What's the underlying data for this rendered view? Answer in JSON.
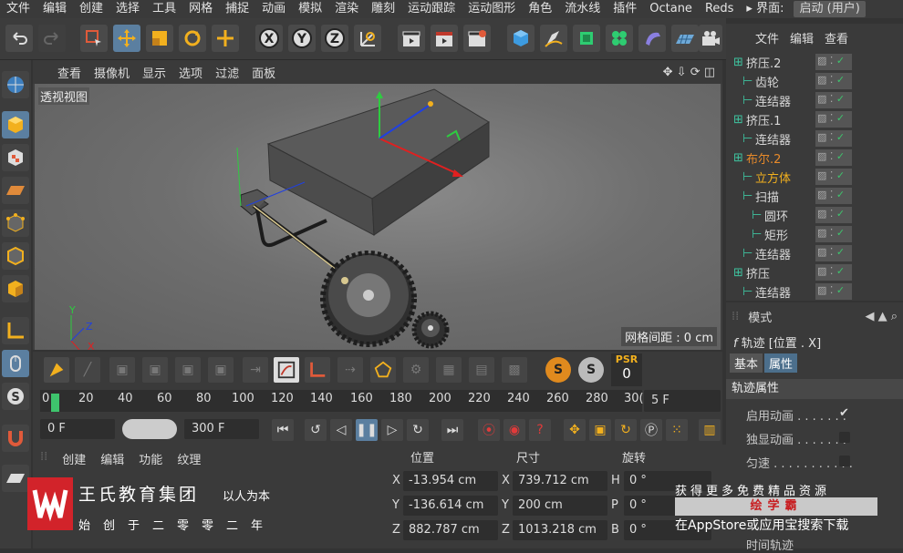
{
  "menubar": {
    "items": [
      "文件",
      "编辑",
      "创建",
      "选择",
      "工具",
      "网格",
      "捕捉",
      "动画",
      "模拟",
      "渲染",
      "雕刻",
      "运动跟踪",
      "运动图形",
      "角色",
      "流水线",
      "插件",
      "Octane",
      "Reds"
    ],
    "layout_label": "界面:",
    "layout_value": "启动 (用户)"
  },
  "viewport": {
    "menu": [
      "查看",
      "摄像机",
      "显示",
      "选项",
      "过滤",
      "面板"
    ],
    "view_name": "透视视图",
    "grid_spacing": "网格间距 : 0 cm"
  },
  "anim": {
    "psr": "PSR",
    "psr_value": "0"
  },
  "timeline": {
    "ticks": [
      "0",
      "20",
      "40",
      "60",
      "80",
      "100",
      "120",
      "140",
      "160",
      "180",
      "200",
      "220",
      "240",
      "260",
      "280",
      "30("
    ],
    "current_frame": "5 F"
  },
  "transport": {
    "start": "0 F",
    "end": "300 F"
  },
  "material": {
    "menu": [
      "创建",
      "编辑",
      "功能",
      "纹理"
    ]
  },
  "coords": {
    "headers": [
      "位置",
      "尺寸",
      "旋转"
    ],
    "rows": [
      {
        "axis": "X",
        "pos": "-13.954 cm",
        "size_axis": "X",
        "size": "739.712 cm",
        "rot_axis": "H",
        "rot": "0 °"
      },
      {
        "axis": "Y",
        "pos": "-136.614 cm",
        "size_axis": "Y",
        "size": "200 cm",
        "rot_axis": "P",
        "rot": "0 °"
      },
      {
        "axis": "Z",
        "pos": "882.787 cm",
        "size_axis": "Z",
        "size": "1013.218 cm",
        "rot_axis": "B",
        "rot": "0 °"
      }
    ]
  },
  "objects": {
    "menu": [
      "文件",
      "编辑",
      "查看"
    ],
    "items": [
      {
        "name": "挤压.2",
        "indent": 0,
        "color": "#d8d8d8"
      },
      {
        "name": "齿轮",
        "indent": 1,
        "color": "#d8d8d8"
      },
      {
        "name": "连结器",
        "indent": 1,
        "color": "#d8d8d8"
      },
      {
        "name": "挤压.1",
        "indent": 0,
        "color": "#d8d8d8"
      },
      {
        "name": "连结器",
        "indent": 1,
        "color": "#d8d8d8"
      },
      {
        "name": "布尔.2",
        "indent": 0,
        "color": "#e88a2a"
      },
      {
        "name": "立方体",
        "indent": 1,
        "color": "#f2b01e"
      },
      {
        "name": "扫描",
        "indent": 1,
        "color": "#d8d8d8"
      },
      {
        "name": "圆环",
        "indent": 2,
        "color": "#d8d8d8"
      },
      {
        "name": "矩形",
        "indent": 2,
        "color": "#d8d8d8"
      },
      {
        "name": "连结器",
        "indent": 1,
        "color": "#d8d8d8"
      },
      {
        "name": "挤压",
        "indent": 0,
        "color": "#d8d8d8"
      },
      {
        "name": "连结器",
        "indent": 1,
        "color": "#d8d8d8"
      }
    ]
  },
  "attributes": {
    "mode_label": "模式",
    "title": "轨迹 [位置 . X]",
    "tabs": [
      "基本",
      "属性"
    ],
    "section": "轨迹属性",
    "rows": [
      {
        "label": "启用动画 . . . . . . .",
        "checked": true
      },
      {
        "label": "独显动画 . . . . . . .",
        "checked": false
      },
      {
        "label": "匀速 . . . . . . . . . . .",
        "checked": false
      },
      {
        "label": "时间轨迹",
        "checked": false
      }
    ]
  },
  "watermark": {
    "name": "王氏教育集团",
    "slogan": "以人为本",
    "sub": "始创于二零零二年",
    "ad_line1": "获得更多免费精品资源",
    "ad_brand": "绘学霸",
    "ad_line2": "在AppStore或应用宝搜索下载"
  },
  "colors": {
    "accent": "#4c6f8c",
    "selection": "#f2b01e",
    "playhead": "#3ec46d"
  }
}
